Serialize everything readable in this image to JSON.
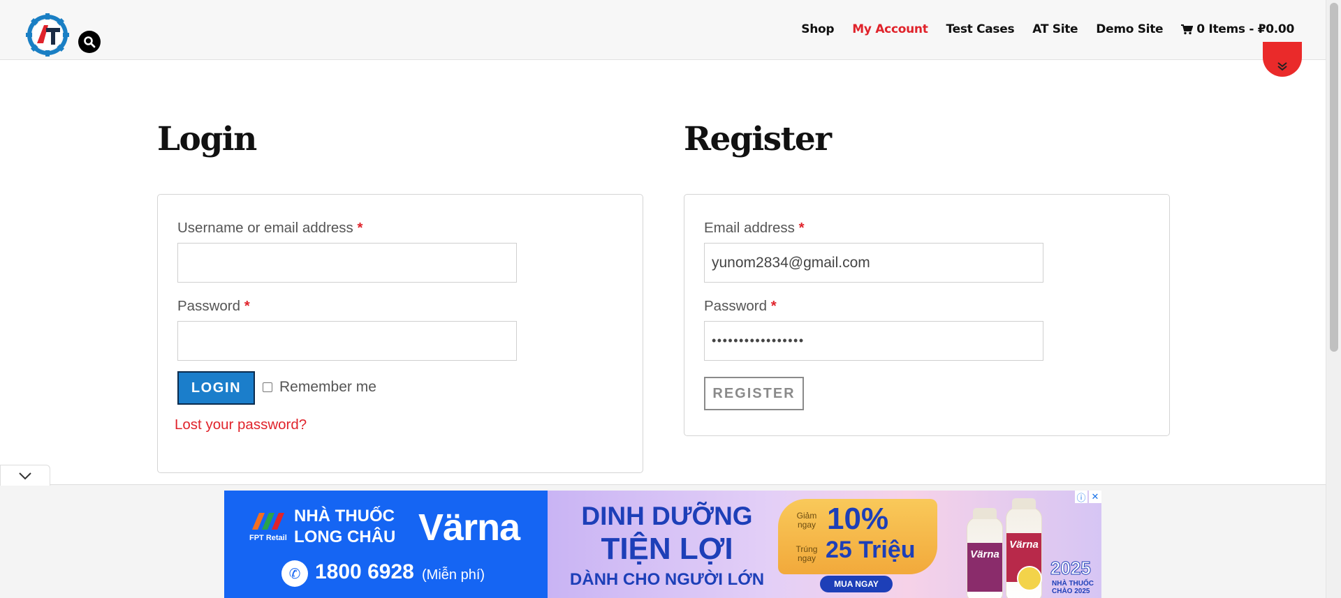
{
  "header": {
    "nav": [
      {
        "label": "Shop",
        "active": false
      },
      {
        "label": "My Account",
        "active": true
      },
      {
        "label": "Test Cases",
        "active": false
      },
      {
        "label": "AT Site",
        "active": false
      },
      {
        "label": "Demo Site",
        "active": false
      }
    ],
    "cart_label": "0 Items - ₽0.00"
  },
  "login": {
    "title": "Login",
    "username_label": "Username or email address",
    "username_value": "",
    "password_label": "Password",
    "password_value": "",
    "required_mark": "*",
    "button": "LOGIN",
    "remember_label": "Remember me",
    "remember_checked": false,
    "lost_password": "Lost your password?"
  },
  "register": {
    "title": "Register",
    "email_label": "Email address",
    "email_value": "yunom2834@gmail.com",
    "password_label": "Password",
    "password_value": "•••••••••••••••••",
    "button": "REGISTER"
  },
  "ad": {
    "pharmacy_line1": "NHÀ THUỐC",
    "pharmacy_line2": "LONG CHÂU",
    "fpt_label": "FPT Retail",
    "brand": "Värna",
    "phone": "1800 6928",
    "phone_note": "(Miễn phí)",
    "headline1": "DINH DƯỠNG",
    "headline2": "TIỆN LỢI",
    "headline3": "DÀNH CHO NGƯỜI LỚN",
    "promo_small1": "Giảm ngay",
    "promo_big1": "10%",
    "promo_small2": "Trúng ngay",
    "promo_big2": "25 Triệu",
    "buy_button": "MUA NGAY",
    "year": "2025",
    "year_sub1": "NHÀ THUỐC",
    "year_sub2": "CHÀO 2025",
    "colors": {
      "left_bg": "#1565f3",
      "headline": "#1d3fb8",
      "promo": "#f2a93b"
    }
  },
  "colors": {
    "accent": "#e0232b",
    "login_button": "#1b7ecb"
  }
}
